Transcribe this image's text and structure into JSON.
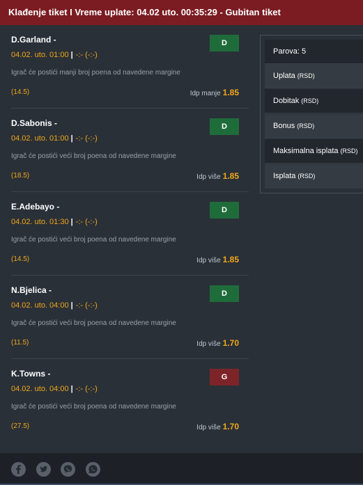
{
  "header": {
    "title": "Klađenje tiket I Vreme uplate: 04.02 uto. 00:35:29 - Gubitan tiket"
  },
  "bets": [
    {
      "player": "D.Garland -",
      "date": "04.02. uto. 01:00",
      "score": "-:- (-:-)",
      "description": "Igrač će postići manji broj poena od navedene margine",
      "margin": "(14.5)",
      "odd_label": "Idp manje",
      "odd": "1.85",
      "result": "D",
      "status_color": "#1f6c3b"
    },
    {
      "player": "D.Sabonis -",
      "date": "04.02. uto. 01:00",
      "score": "-:- (-:-)",
      "description": "Igrač će postići veći broj poena od navedene margine",
      "margin": "(18.5)",
      "odd_label": "Idp više",
      "odd": "1.85",
      "result": "D",
      "status_color": "#1f6c3b"
    },
    {
      "player": "E.Adebayo -",
      "date": "04.02. uto. 01:30",
      "score": "-:- (-:-)",
      "description": "Igrač će postići veći broj poena od navedene margine",
      "margin": "(14.5)",
      "odd_label": "Idp više",
      "odd": "1.85",
      "result": "D",
      "status_color": "#1f6c3b"
    },
    {
      "player": "N.Bjelica -",
      "date": "04.02. uto. 04:00",
      "score": "-:- (-:-)",
      "description": "Igrač će postići veći broj poena od navedene margine",
      "margin": "(11.5)",
      "odd_label": "Idp više",
      "odd": "1.70",
      "result": "D",
      "status_color": "#1f6c3b"
    },
    {
      "player": "K.Towns -",
      "date": "04.02. uto. 04:00",
      "score": "-:- (-:-)",
      "description": "Igrač će postići veći broj poena od navedene margine",
      "margin": "(27.5)",
      "odd_label": "Idp više",
      "odd": "1.70",
      "result": "G",
      "status_color": "#7d2428"
    }
  ],
  "summary": {
    "parovi": "Parova: 5",
    "uplata": "Uplata",
    "dobitak": "Dobitak",
    "bonus": "Bonus",
    "maks": "Maksimalna isplata",
    "isplata": "Isplata",
    "unit": "(RSD)"
  },
  "footer": {
    "icons": [
      "facebook-icon",
      "twitter-icon",
      "viber-icon",
      "whatsapp-icon"
    ]
  },
  "colors": {
    "header": "#7b1c22",
    "accent": "#f0a818",
    "won": "#1f6c3b",
    "lost": "#7d2428"
  }
}
